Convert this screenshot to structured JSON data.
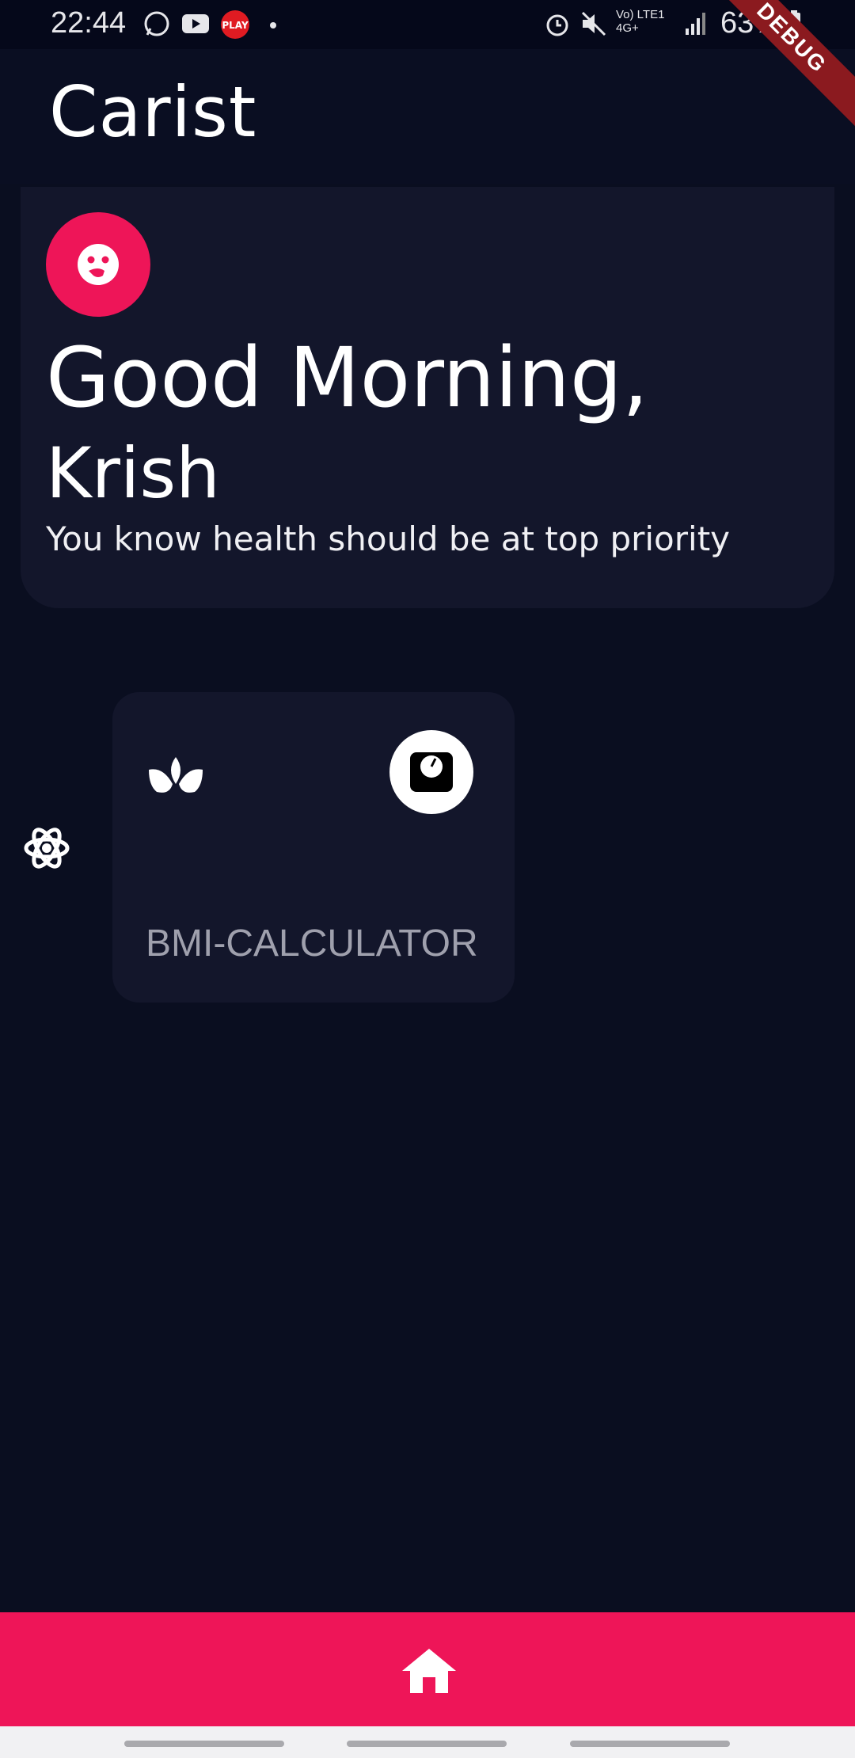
{
  "status_bar": {
    "time": "22:44",
    "battery": "63%",
    "network_label": "Vo) LTE1 4G+",
    "icons": [
      "whatsapp-icon",
      "youtube-icon",
      "play-icon",
      "dot-icon",
      "alarm-icon",
      "mute-icon",
      "signal-icon",
      "battery-icon"
    ]
  },
  "app_bar": {
    "title": "Carist",
    "debug_label": "DEBUG"
  },
  "greeting": {
    "line": "Good Morning,",
    "name": "Krish",
    "subtitle": "You know health should be at top priority"
  },
  "cards": [
    {
      "label": "BMI-CALCULATOR",
      "left_icon": "lotus-icon",
      "right_icon": "scale-icon"
    }
  ],
  "bottom_bar": {
    "icon": "home-icon"
  },
  "colors": {
    "background": "#0a0e20",
    "card": "#13162b",
    "accent": "#ee1558",
    "card_label": "#9fa0ad"
  }
}
